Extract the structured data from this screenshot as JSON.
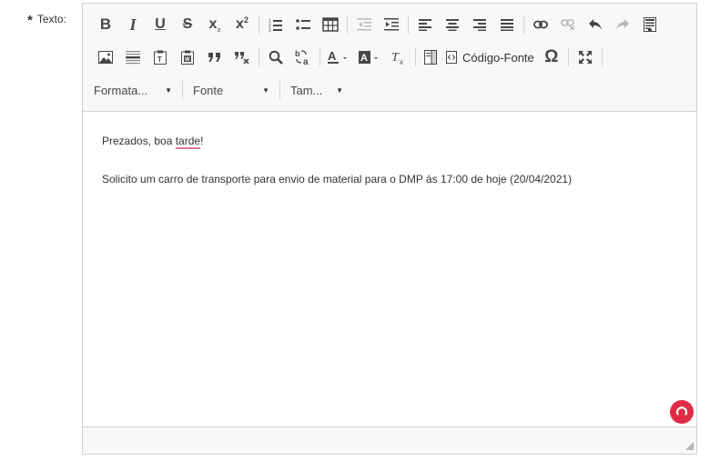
{
  "field": {
    "required_mark": "*",
    "label": "Texto:"
  },
  "toolbar": {
    "row1": [
      {
        "name": "bold-icon",
        "glyph": "B"
      },
      {
        "name": "italic-icon",
        "glyph": "I"
      },
      {
        "name": "underline-icon",
        "glyph": "U"
      },
      {
        "name": "strikethrough-icon",
        "glyph": "S"
      },
      {
        "name": "subscript-icon",
        "glyph": "x₂"
      },
      {
        "name": "superscript-icon",
        "glyph": "x²"
      }
    ],
    "source_label": "Código-Fonte",
    "format_label": "Formata...",
    "font_label": "Fonte",
    "size_label": "Tam...",
    "omega": "Ω"
  },
  "content": {
    "greeting_prefix": "Prezados, boa ",
    "greeting_misspelled": "tarde",
    "greeting_suffix": "!",
    "body": "Solicito um carro de transporte para envio de material para o DMP às 17:00 de hoje (20/04/2021)"
  },
  "colors": {
    "toolbar_bg": "#f8f8f8",
    "border": "#d1d1d1",
    "grammarly": "#e02b46",
    "spell_underline": "#e07a9a"
  }
}
